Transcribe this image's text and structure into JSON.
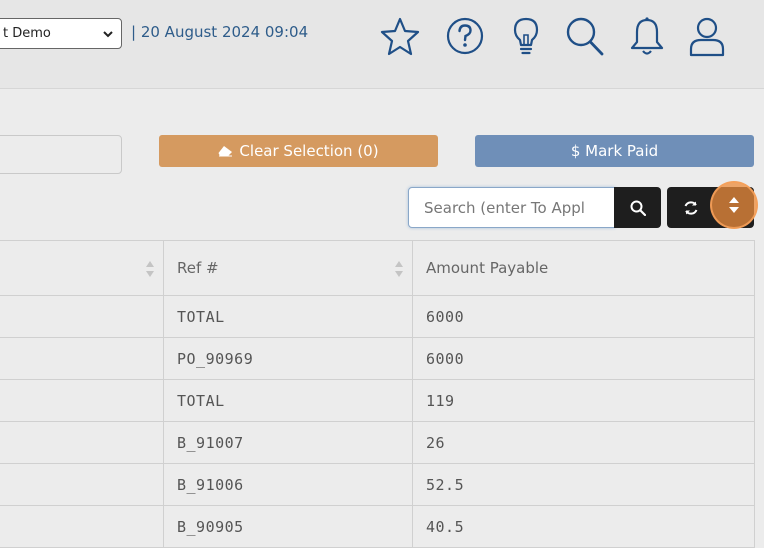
{
  "header": {
    "company_select_value": "t Demo",
    "datetime": "| 20 August 2024 09:04",
    "icons": [
      "star-icon",
      "help-icon",
      "lightbulb-icon",
      "search-icon",
      "bell-icon",
      "user-icon"
    ]
  },
  "toolbar": {
    "clear_selection_label": "Clear Selection (0)",
    "mark_paid_label": "$ Mark Paid",
    "search_placeholder": "Search (enter To Appl"
  },
  "colors": {
    "clear_selection": "#d59a60",
    "mark_paid": "#6f8fb8",
    "datetime_text": "#2e5c8a",
    "highlight": "#ec8c3c"
  },
  "table": {
    "columns": [
      "",
      "Ref #",
      "Amount Payable"
    ],
    "rows": [
      {
        "ref": "TOTAL",
        "amount": "6000"
      },
      {
        "ref": "PO_90969",
        "amount": "6000"
      },
      {
        "ref": "TOTAL",
        "amount": "119"
      },
      {
        "ref": "B_91007",
        "amount": "26"
      },
      {
        "ref": "B_91006",
        "amount": "52.5"
      },
      {
        "ref": "B_90905",
        "amount": "40.5"
      }
    ]
  }
}
